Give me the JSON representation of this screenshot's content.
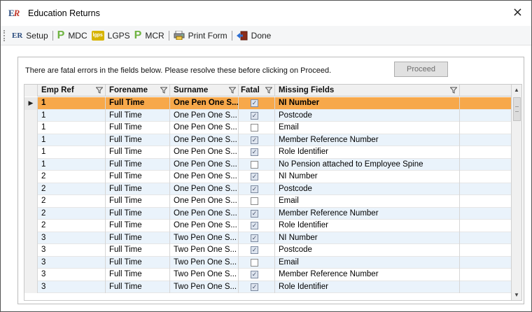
{
  "window": {
    "title": "Education Returns",
    "close_glyph": "×",
    "logo_text_e": "E",
    "logo_text_r": "R"
  },
  "toolbar": {
    "setup_label": "Setup",
    "mdc_label": "MDC",
    "lgps_label": "LGPS",
    "mcr_label": "MCR",
    "print_label": "Print Form",
    "done_label": "Done",
    "setup_icon_text": "ER",
    "p_icon_text": "P",
    "lgps_icon_text": "lgps"
  },
  "panel": {
    "message": "There are fatal errors in the fields below. Please resolve these before clicking on Proceed.",
    "proceed_label": "Proceed"
  },
  "grid": {
    "columns": [
      "Emp Ref",
      "Forename",
      "Surname",
      "Fatal",
      "Missing Fields"
    ],
    "current_row_glyph": "▶",
    "rows": [
      {
        "emp": "1",
        "forename": "Full Time",
        "surname": "One Pen One S...",
        "fatal": true,
        "missing": "NI Number"
      },
      {
        "emp": "1",
        "forename": "Full Time",
        "surname": "One Pen One S...",
        "fatal": true,
        "missing": "Postcode"
      },
      {
        "emp": "1",
        "forename": "Full Time",
        "surname": "One Pen One S...",
        "fatal": false,
        "missing": "Email"
      },
      {
        "emp": "1",
        "forename": "Full Time",
        "surname": "One Pen One S...",
        "fatal": true,
        "missing": "Member Reference Number"
      },
      {
        "emp": "1",
        "forename": "Full Time",
        "surname": "One Pen One S...",
        "fatal": true,
        "missing": "Role Identifier"
      },
      {
        "emp": "1",
        "forename": "Full Time",
        "surname": "One Pen One S...",
        "fatal": false,
        "missing": "No Pension attached to Employee Spine"
      },
      {
        "emp": "2",
        "forename": "Full Time",
        "surname": "One Pen One S...",
        "fatal": true,
        "missing": "NI Number"
      },
      {
        "emp": "2",
        "forename": "Full Time",
        "surname": "One Pen One S...",
        "fatal": true,
        "missing": "Postcode"
      },
      {
        "emp": "2",
        "forename": "Full Time",
        "surname": "One Pen One S...",
        "fatal": false,
        "missing": "Email"
      },
      {
        "emp": "2",
        "forename": "Full Time",
        "surname": "One Pen One S...",
        "fatal": true,
        "missing": "Member Reference Number"
      },
      {
        "emp": "2",
        "forename": "Full Time",
        "surname": "One Pen One S...",
        "fatal": true,
        "missing": "Role Identifier"
      },
      {
        "emp": "3",
        "forename": "Full Time",
        "surname": "Two Pen One S...",
        "fatal": true,
        "missing": "NI Number"
      },
      {
        "emp": "3",
        "forename": "Full Time",
        "surname": "Two Pen One S...",
        "fatal": true,
        "missing": "Postcode"
      },
      {
        "emp": "3",
        "forename": "Full Time",
        "surname": "Two Pen One S...",
        "fatal": false,
        "missing": "Email"
      },
      {
        "emp": "3",
        "forename": "Full Time",
        "surname": "Two Pen One S...",
        "fatal": true,
        "missing": "Member Reference Number"
      },
      {
        "emp": "3",
        "forename": "Full Time",
        "surname": "Two Pen One S...",
        "fatal": true,
        "missing": "Role Identifier"
      }
    ],
    "selected_row_index": 0
  },
  "colors": {
    "selected_row": "#f7a84a",
    "alt_row": "#eaf3fb",
    "header_bg": "#f0f0f0"
  },
  "icons": {
    "setup": "er-logo-icon",
    "mdc": "p-green-icon",
    "lgps": "lgps-icon",
    "mcr": "p-green-icon",
    "print": "printer-icon",
    "done": "exit-door-icon",
    "filter": "funnel-icon",
    "close": "close-icon"
  }
}
